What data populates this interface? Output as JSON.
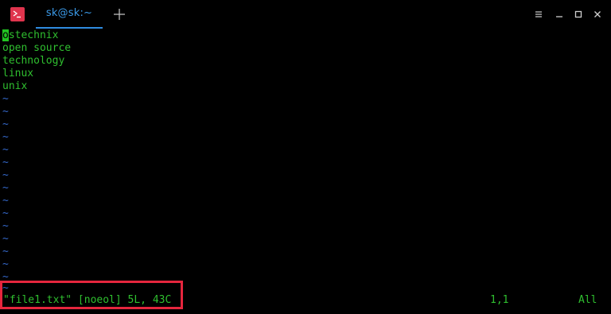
{
  "window": {
    "tab_title": "sk@sk:~"
  },
  "icons": {
    "app": "terminal-app-icon",
    "new_tab": "plus-icon",
    "menu": "hamburger-menu-icon",
    "minimize": "minimize-icon",
    "maximize": "maximize-icon",
    "close": "close-icon"
  },
  "colors": {
    "text": "#2fbf2f",
    "tilde": "#3467c8",
    "cursor": "#22c422",
    "tab_accent": "#2f8ce0",
    "highlight": "#e5263d",
    "app_icon": "#e0344d"
  },
  "editor": {
    "cursor_char": "o",
    "first_line_rest": "stechnix",
    "lines": [
      "open source",
      "technology",
      "linux",
      "unix"
    ],
    "empty_line_marker": "~"
  },
  "status": {
    "file_info": "\"file1.txt\" [noeol] 5L, 43C",
    "position": "1,1",
    "scroll": "All"
  }
}
